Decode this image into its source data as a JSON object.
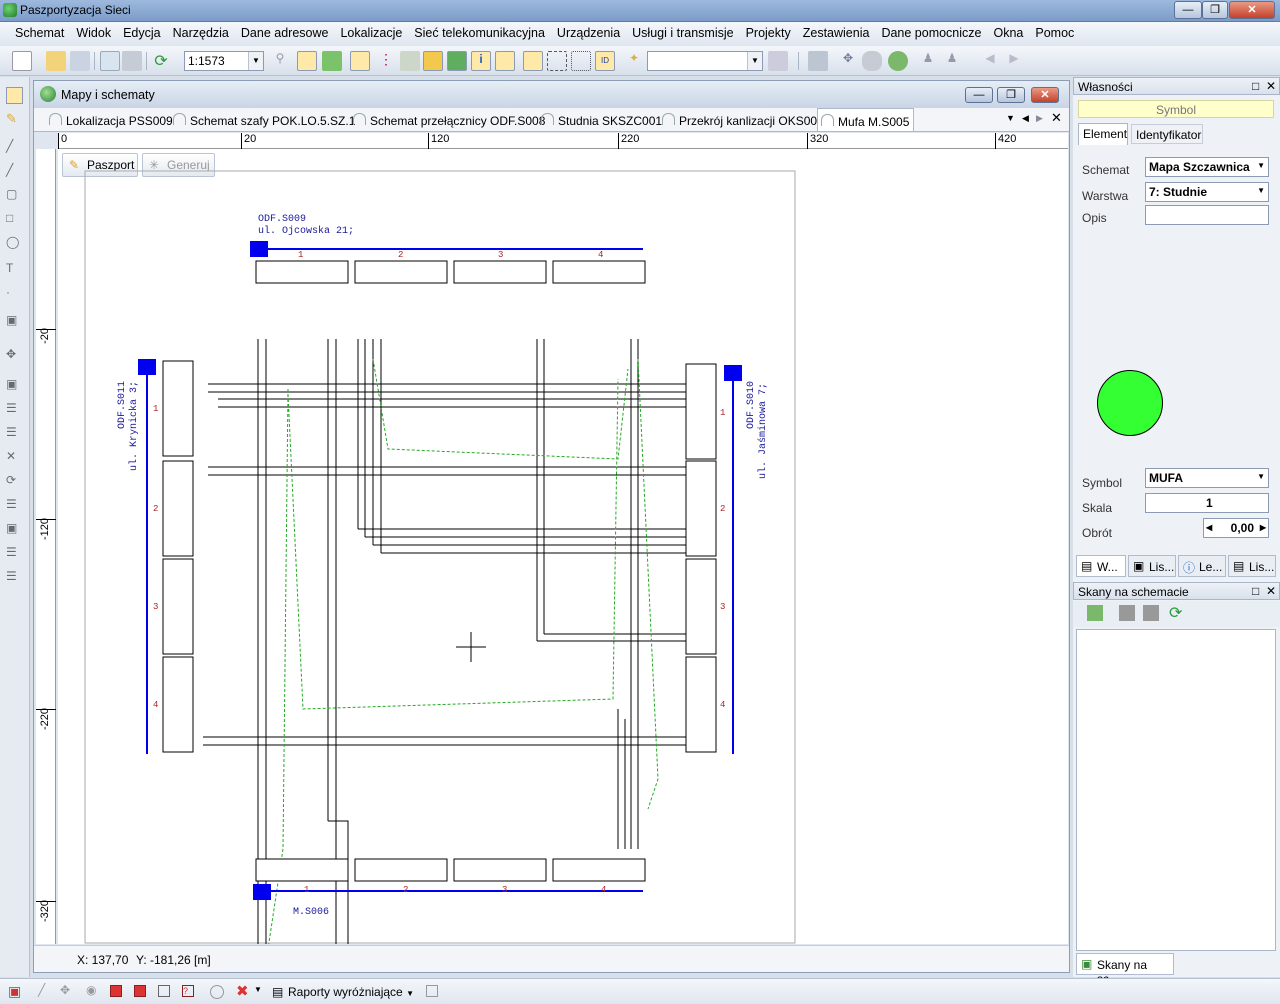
{
  "window": {
    "title": "Paszportyzacja Sieci"
  },
  "menu": [
    "Schemat",
    "Widok",
    "Edycja",
    "Narzędzia",
    "Dane adresowe",
    "Lokalizacje",
    "Sieć telekomunikacyjna",
    "Urządzenia",
    "Usługi i transmisje",
    "Projekty",
    "Zestawienia",
    "Dane pomocnicze",
    "Okna",
    "Pomoc"
  ],
  "toolbar": {
    "scale": "1:1573"
  },
  "doc": {
    "title": "Mapy i schematy",
    "tabs": [
      "Lokalizacja PSS009",
      "Schemat szafy POK.LO.5.SZ.1",
      "Schemat przełącznicy ODF.S008",
      "Studnia SKSZC001",
      "Przekrój kanlizacji OKS006",
      "Mufa M.S005"
    ],
    "paszport": "Paszport",
    "generuj": "Generuj",
    "ruler_top": [
      "0",
      "20",
      "120",
      "220",
      "320",
      "420"
    ],
    "ruler_left": [
      "-20",
      "-120",
      "-220",
      "-320"
    ],
    "status_x": "X: 137,70",
    "status_y": "Y: -181,26 [m]"
  },
  "schematic": {
    "top_name": "ODF.S009",
    "top_addr": "ul. Ojcowska 21;",
    "left_name": "ODF.S011",
    "left_addr": "ul. Krynicka 3;",
    "right_name": "ODF.S010",
    "right_addr": "ul. Jaśminowa 7;",
    "bottom_name": "M.S006",
    "groups": [
      "1",
      "2",
      "3",
      "4"
    ]
  },
  "props": {
    "title": "Własności",
    "symbol_header": "Symbol",
    "tab_element": "Element",
    "tab_identyfikator": "Identyfikator",
    "schemat_label": "Schemat",
    "schemat_value": "Mapa Szczawnica",
    "warstwa_label": "Warstwa",
    "warstwa_value": "7: Studnie",
    "opis_label": "Opis",
    "opis_value": "",
    "symbol_label": "Symbol",
    "symbol_value": "MUFA",
    "skala_label": "Skala",
    "skala_value": "1",
    "obrot_label": "Obrót",
    "obrot_value": "0,00",
    "symbol_color": "#33ff33",
    "bottom_tabs": [
      "W...",
      "Lis...",
      "Le...",
      "Lis..."
    ]
  },
  "scans": {
    "title": "Skany na schemacie",
    "footer_tab": "Skany na sc..."
  },
  "bottombar": {
    "raporty": "Raporty wyróżniające"
  }
}
